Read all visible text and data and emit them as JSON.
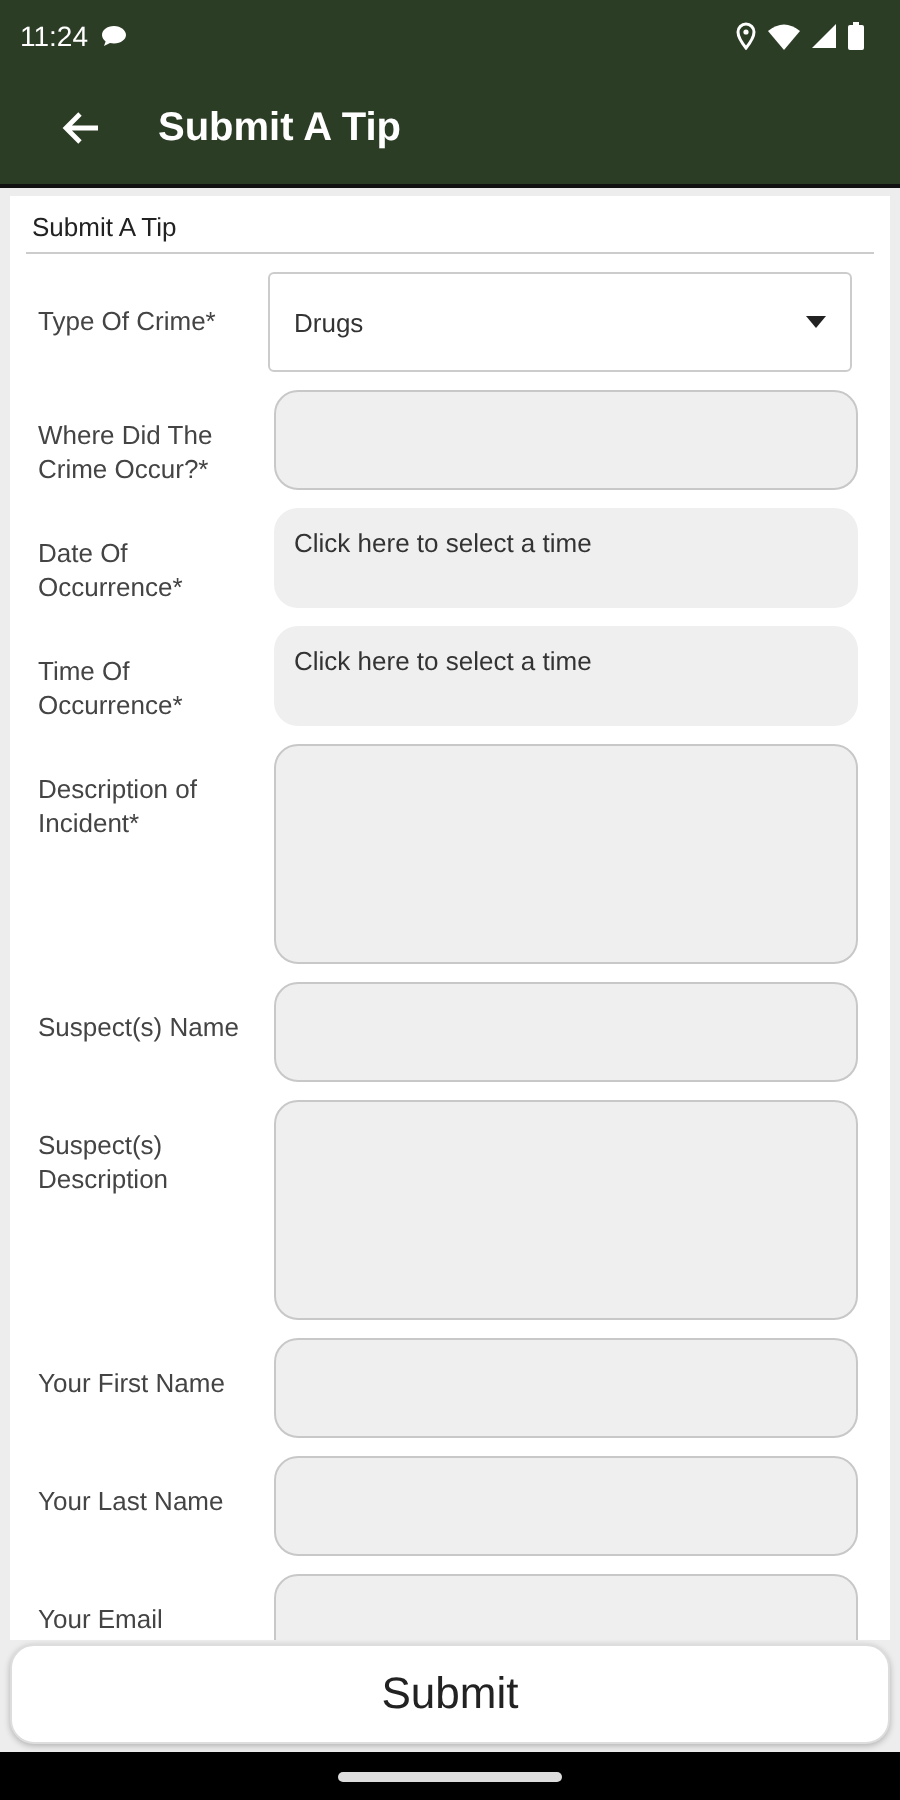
{
  "status_bar": {
    "time": "11:24"
  },
  "app_bar": {
    "title": "Submit A Tip"
  },
  "form": {
    "title": "Submit A Tip",
    "fields": [
      {
        "kind": "select",
        "label": "Type Of Crime*",
        "value": "Drugs"
      },
      {
        "kind": "text",
        "label": "Where Did The Crime Occur?*"
      },
      {
        "kind": "picker",
        "label": "Date Of Occurrence*",
        "placeholder": "Click here to select a time"
      },
      {
        "kind": "picker",
        "label": "Time Of Occurrence*",
        "placeholder": "Click here to select a time"
      },
      {
        "kind": "textarea",
        "label": "Description of Incident*"
      },
      {
        "kind": "text",
        "label": "Suspect(s) Name"
      },
      {
        "kind": "textarea",
        "label": "Suspect(s) Description"
      },
      {
        "kind": "text",
        "label": "Your First Name"
      },
      {
        "kind": "text",
        "label": "Your Last Name"
      },
      {
        "kind": "text",
        "label": "Your Email"
      }
    ]
  },
  "submit_button": "Submit"
}
